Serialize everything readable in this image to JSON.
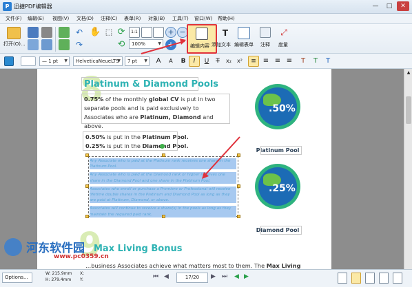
{
  "app": {
    "title": "迅捷PDF编辑器",
    "window_controls": {
      "minimize": "—",
      "maximize": "□",
      "close": "✕"
    }
  },
  "menu": [
    "文件(F)",
    "编辑(E)",
    "视图(V)",
    "文档(D)",
    "注释(C)",
    "表单(R)",
    "对象(B)",
    "工具(T)",
    "窗口(W)",
    "帮助(H)"
  ],
  "toolbar": {
    "open_label": "打开(O)...",
    "zoom_value": "100%",
    "edit_content_label": "编辑内容",
    "add_text_label": "添加文本",
    "edit_form_label": "编辑表单",
    "annotate_label": "注释",
    "measure_label": "度量"
  },
  "format_bar": {
    "line_width": "— 1 pt",
    "font": "HelveticaNeueLTS",
    "font_size": "7 pt",
    "bold": "B",
    "italic": "I",
    "underline": "U",
    "strike": "T",
    "subscript": "x₂",
    "superscript": "x²"
  },
  "document": {
    "section1_title": "Platinum & Diamond Pools",
    "para1": {
      "a": "0.75%",
      "b": " of the monthly ",
      "c": "global CV",
      "d": " is put in two separate pools and is paid exclusively to Associates who are ",
      "e": "Platinum, Diamond",
      "f": " and above."
    },
    "para2_line1": {
      "a": "0.50%",
      "b": " is put in the ",
      "c": "Platinum Pool."
    },
    "para2_line2": {
      "a": "0.25%",
      "b": " is put in the ",
      "c": "Diamond Pool."
    },
    "selected_paragraphs": [
      "Any Associate who is paid at the Platinum rank receives one share in the Platinum Pool.",
      "Any Associate who is paid at the Diamond rank or higher receives one share in the Diamond Pool and one share in the Platinum Pool.",
      "Associates who enroll or purchase a Premiere or Professional will receive lifetime double shares in the Platinum and Diamond Pool as long as they are paid at Platinum, Diamond, or above.",
      "Associates will continue to receive a share(s) in the pools as long as they maintain the required paid rank."
    ],
    "badge1": {
      "value": ".50%",
      "caption": "Platinum Pool"
    },
    "badge2": {
      "value": ".25%",
      "caption": "Diamond Pool"
    },
    "section2_title": "Max Living Bonus",
    "section2_text": {
      "a": "…business Associates achieve what matters most to them. The ",
      "b": "Max Living"
    },
    "section2_digit": "9"
  },
  "statusbar": {
    "options": "Options...",
    "width": "W: 215.9mm",
    "height": "H: 279.4mm",
    "xcoord": "X:",
    "ycoord": "Y:",
    "page": "17",
    "page_total": "/20"
  },
  "watermark": {
    "brand": "河东软件园",
    "url": "www.pc0359.cn"
  },
  "colors": {
    "accent": "#2fb3b4",
    "highlight": "#e0313b",
    "selection": "#a7c9f0",
    "globe_green": "#2eb37f",
    "globe_blue": "#1c6bb5"
  }
}
